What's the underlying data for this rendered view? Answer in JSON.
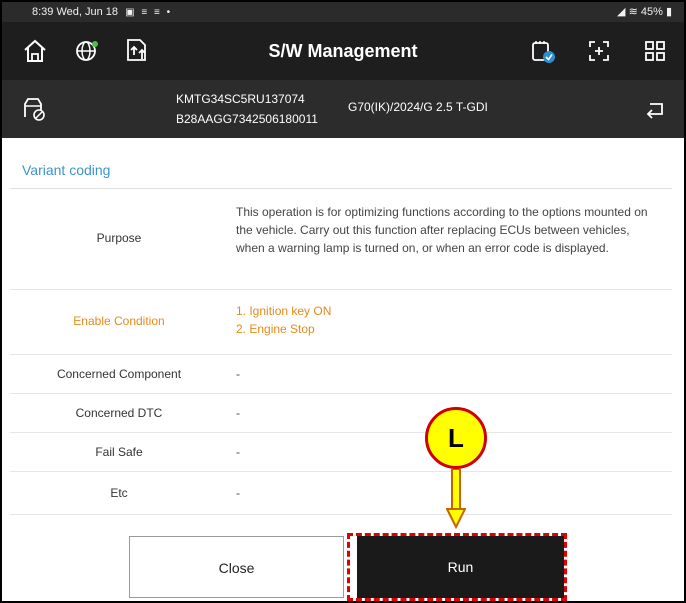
{
  "status_bar": {
    "time": "8:39",
    "date": "Wed, Jun 18",
    "battery": "45%"
  },
  "app_bar": {
    "title": "S/W Management",
    "icons": [
      "home-icon",
      "globe-settings-icon",
      "upload-document-icon",
      "diagnostic-icon",
      "expand-icon",
      "grid-icon"
    ]
  },
  "vehicle": {
    "vin_line1": "KMTG34SC5RU137074",
    "vin_line2": "B28AAGG7342506180011",
    "model": "G70(IK)/2024/G 2.5 T-GDI"
  },
  "section": {
    "title": "Variant coding"
  },
  "rows": [
    {
      "label": "Purpose",
      "value": "This operation is for optimizing functions according to the options mounted on the vehicle. Carry out this function after replacing ECUs between vehicles, when a warning lamp is turned on, or when an error code is displayed."
    },
    {
      "label": "Enable Condition",
      "value_lines": [
        "1. Ignition key ON",
        "2. Engine Stop"
      ]
    },
    {
      "label": "Concerned Component",
      "value": "-"
    },
    {
      "label": "Concerned DTC",
      "value": "-"
    },
    {
      "label": "Fail Safe",
      "value": "-"
    },
    {
      "label": "Etc",
      "value": "-"
    }
  ],
  "buttons": {
    "close": "Close",
    "run": "Run"
  },
  "annotation": {
    "marker_label": "L"
  },
  "colors": {
    "section_title": "#3a96c8",
    "enable_condition": "#e58a1a",
    "highlight": "#e00000",
    "marker_fill": "#ffff00"
  }
}
